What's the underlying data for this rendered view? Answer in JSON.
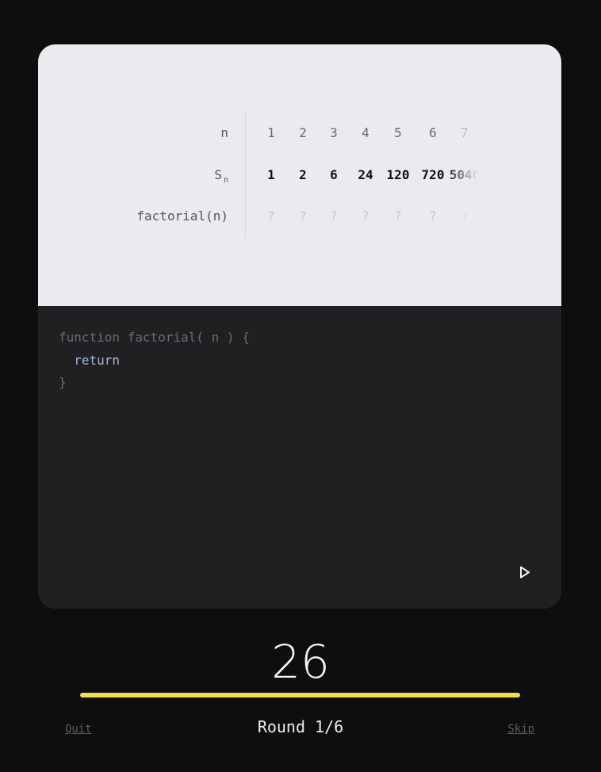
{
  "table": {
    "row_labels": {
      "n": "n",
      "s_main": "S",
      "s_sub": "n",
      "f": "factorial(n)"
    },
    "columns": [
      {
        "n": "1",
        "s": "1",
        "f": "?"
      },
      {
        "n": "2",
        "s": "2",
        "f": "?"
      },
      {
        "n": "3",
        "s": "6",
        "f": "?"
      },
      {
        "n": "4",
        "s": "24",
        "f": "?"
      },
      {
        "n": "5",
        "s": "120",
        "f": "?"
      },
      {
        "n": "6",
        "s": "720",
        "f": "?"
      },
      {
        "n": "7",
        "s": "5040",
        "f": "?"
      }
    ]
  },
  "code": {
    "line1": "function factorial( n ) {",
    "line2_kw": "return",
    "line3": "}"
  },
  "run_icon": "play-icon",
  "score": "26",
  "progress": 1.0,
  "progress_color": "#f2db57",
  "round_label": "Round 1/6",
  "quit_label": "Quit",
  "skip_label": "Skip"
}
